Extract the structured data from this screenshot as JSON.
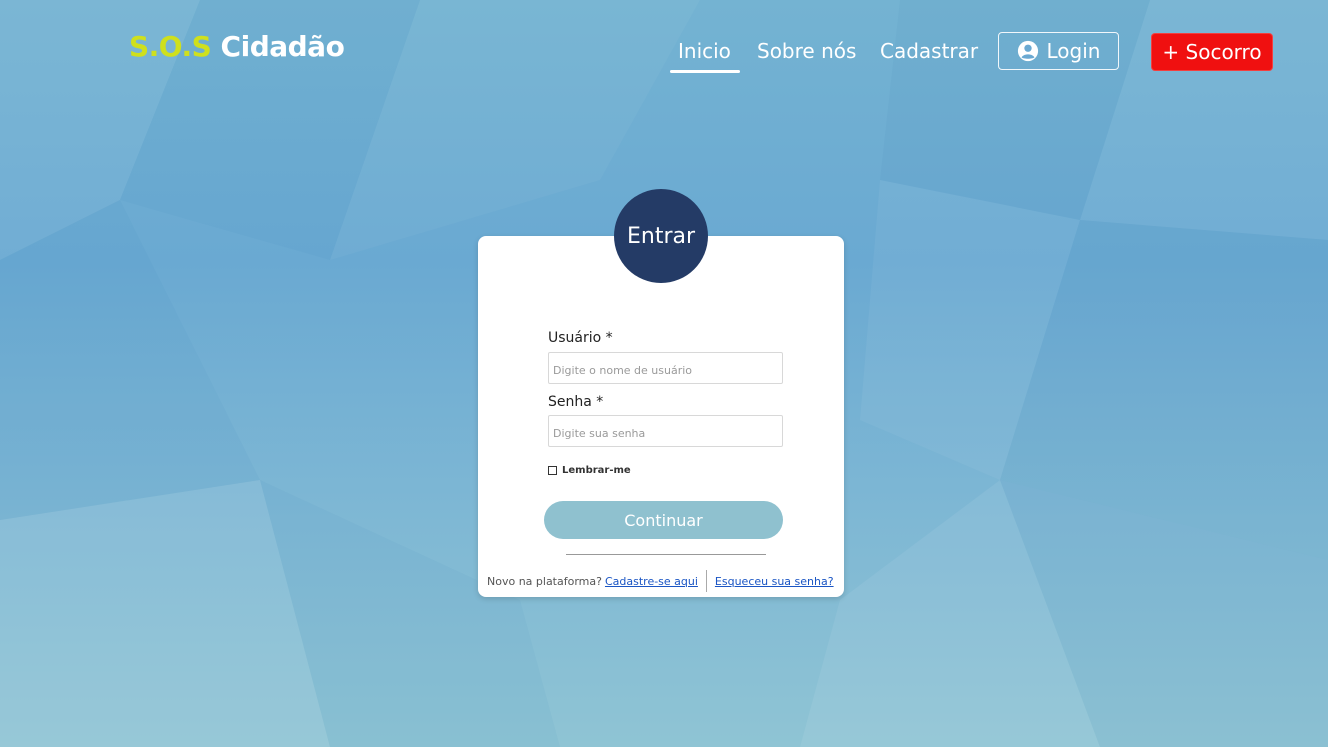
{
  "brand": {
    "prefix": "S.O.S",
    "name": "Cidadão"
  },
  "nav": {
    "items": [
      {
        "label": "Inicio",
        "active": true
      },
      {
        "label": "Sobre nós"
      },
      {
        "label": "Cadastrar"
      }
    ],
    "login_label": "Login",
    "help_label": "+ Socorro"
  },
  "card": {
    "badge": "Entrar",
    "username": {
      "label": "Usuário *",
      "placeholder": "Digite o nome de usuário",
      "value": ""
    },
    "password": {
      "label": "Senha *",
      "placeholder": "Digite sua senha",
      "value": ""
    },
    "remember_label": "Lembrar-me",
    "submit_label": "Continuar",
    "footer": {
      "new_text": "Novo na plataforma?",
      "signup_link": "Cadastre-se aqui",
      "forgot_link": "Esqueceu sua senha?"
    }
  },
  "colors": {
    "brand_accent": "#cfe01d",
    "badge_bg": "#243b66",
    "help_bg": "#f01010",
    "submit_bg": "#8fc1cf",
    "link": "#1a55c4"
  }
}
